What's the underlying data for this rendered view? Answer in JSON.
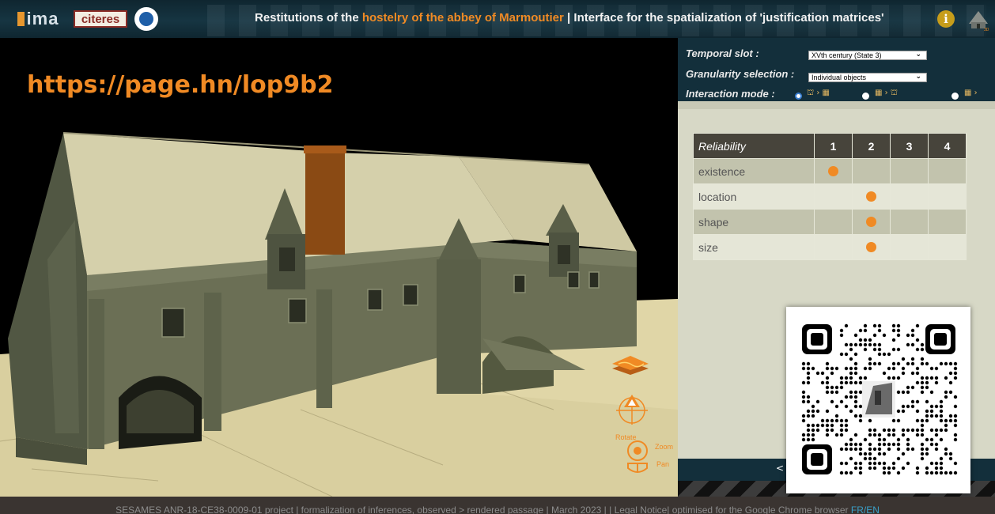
{
  "header": {
    "logos": {
      "imar": "ima",
      "citeres": "citeres"
    },
    "title_prefix": "Restitutions of the ",
    "title_highlight": "hostelry of the abbey of Marmoutier",
    "title_suffix": " | Interface for the spatialization of 'justification matrices'",
    "info_icon": "i"
  },
  "viewport": {
    "watermark_url": "https://page.hn/lop9b2",
    "controls": {
      "layers_icon": "layers-icon",
      "orbit_icon": "orbit-icon",
      "rotate_label": "Rotate",
      "zoom_label": "Zoom",
      "pan_label": "Pan"
    }
  },
  "controls": {
    "temporal_label": "Temporal slot :",
    "temporal_value": "XVth century (State 3)",
    "granularity_label": "Granularity selection :",
    "granularity_value": "Individual objects",
    "interaction_label": "Interaction mode :",
    "interaction_modes": [
      "mode-1",
      "mode-2",
      "mode-3"
    ],
    "interaction_selected": 0
  },
  "matrix": {
    "header": [
      "Reliability",
      "1",
      "2",
      "3",
      "4"
    ],
    "rows": [
      {
        "label": "existence",
        "level": 1
      },
      {
        "label": "location",
        "level": 2
      },
      {
        "label": "shape",
        "level": 2
      },
      {
        "label": "size",
        "level": 2
      }
    ],
    "dot_color": "#f08a24"
  },
  "panel_footer": {
    "prev": "<"
  },
  "footer": {
    "text": "SESAMES ANR-18-CE38-0009-01 project | formalization of inferences, observed > rendered passage | March 2023 | | Legal Notice| optimised for the Google Chrome browser ",
    "lang": "FR/EN"
  },
  "colors": {
    "accent": "#f08a24",
    "header_bg": "#163542",
    "table_head": "#47443b"
  }
}
